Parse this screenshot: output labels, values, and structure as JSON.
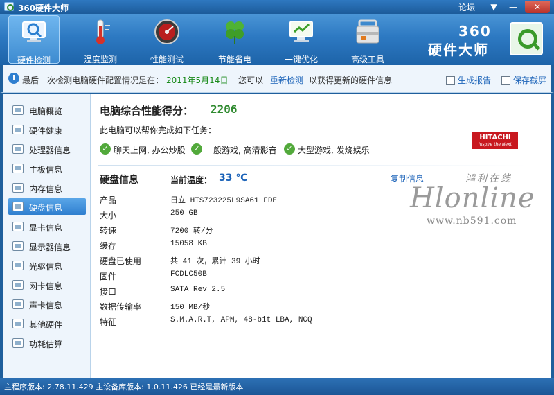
{
  "window": {
    "title": "360硬件大师",
    "forum_link": "论坛",
    "menu_glyph": "▼",
    "min_glyph": "—",
    "close_glyph": "✕"
  },
  "toolbar": {
    "items": [
      {
        "label": "硬件检测",
        "icon": "monitor-magnifier-icon",
        "active": true
      },
      {
        "label": "温度监测",
        "icon": "thermometer-icon",
        "active": false
      },
      {
        "label": "性能测试",
        "icon": "speedometer-icon",
        "active": false
      },
      {
        "label": "节能省电",
        "icon": "clover-icon",
        "active": false
      },
      {
        "label": "一键优化",
        "icon": "optimize-monitor-icon",
        "active": false
      },
      {
        "label": "高级工具",
        "icon": "toolbox-icon",
        "active": false
      }
    ],
    "brand_line1": "360",
    "brand_line2": "硬件大师"
  },
  "infobar": {
    "prefix": "最后一次检测电脑硬件配置情况是在：",
    "date": "2011年5月14日",
    "you_can": "您可以",
    "recheck": "重新检测",
    "suffix": "以获得更新的硬件信息",
    "report": "生成报告",
    "screenshot": "保存截屏"
  },
  "sidebar": {
    "items": [
      {
        "label": "电脑概览",
        "icon": "overview-icon"
      },
      {
        "label": "硬件健康",
        "icon": "health-icon"
      },
      {
        "label": "处理器信息",
        "icon": "cpu-icon"
      },
      {
        "label": "主板信息",
        "icon": "motherboard-icon"
      },
      {
        "label": "内存信息",
        "icon": "memory-icon"
      },
      {
        "label": "硬盘信息",
        "icon": "harddisk-icon",
        "active": true
      },
      {
        "label": "显卡信息",
        "icon": "graphics-card-icon"
      },
      {
        "label": "显示器信息",
        "icon": "display-icon"
      },
      {
        "label": "光驱信息",
        "icon": "optical-drive-icon"
      },
      {
        "label": "网卡信息",
        "icon": "network-card-icon"
      },
      {
        "label": "声卡信息",
        "icon": "sound-card-icon"
      },
      {
        "label": "其他硬件",
        "icon": "other-hardware-icon"
      },
      {
        "label": "功耗估算",
        "icon": "power-icon"
      }
    ]
  },
  "main": {
    "score_title": "电脑综合性能得分：",
    "score_value": "2206",
    "subtitle": "此电脑可以帮你完成如下任务：",
    "tasks": [
      "聊天上网, 办公炒股",
      "一般游戏, 高清影音",
      "大型游戏, 发烧娱乐"
    ],
    "brand_logo": {
      "name": "HITACHI",
      "tagline": "Inspire the Next"
    },
    "disk_title": "硬盘信息",
    "temp_label": "当前温度：",
    "temp_value": "33 ℃",
    "copy_link": "复制信息",
    "details": [
      {
        "key": "产品",
        "value": "日立  HTS723225L9SA61  FDE"
      },
      {
        "key": "大小",
        "value": "250 GB"
      },
      {
        "key": "转速",
        "value": "7200 转/分"
      },
      {
        "key": "缓存",
        "value": "15058 KB"
      },
      {
        "key": "硬盘已使用",
        "value": "共 41 次，累计 39 小时"
      },
      {
        "key": "固件",
        "value": "FCDLC50B"
      },
      {
        "key": "接口",
        "value": "SATA Rev 2.5"
      },
      {
        "key": "数据传输率",
        "value": "150 MB/秒"
      },
      {
        "key": "特征",
        "value": "S.M.A.R.T,  APM,  48-bit LBA,  NCQ"
      }
    ]
  },
  "watermark": {
    "cn": "鸿利在线",
    "big": "Hlonline",
    "url": "www.nb591.com"
  },
  "statusbar": {
    "text": "主程序版本: 2.78.11.429  主设备库版本: 1.0.11.426 已经是最新版本"
  },
  "colors": {
    "accent": "#2f7fcf",
    "score_green": "#2f8a2f",
    "link_blue": "#1a62b8",
    "brand_red": "#c8181f"
  }
}
